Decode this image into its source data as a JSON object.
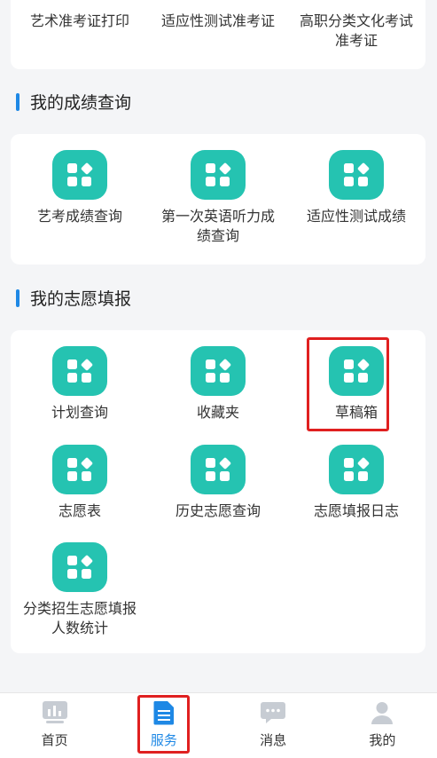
{
  "exam_cards": [
    {
      "label": "艺术准考证打印"
    },
    {
      "label": "适应性测试准考证"
    },
    {
      "label": "高职分类文化考试准考证"
    }
  ],
  "scores_section": {
    "title": "我的成绩查询",
    "items": [
      {
        "label": "艺考成绩查询"
      },
      {
        "label": "第一次英语听力成绩查询"
      },
      {
        "label": "适应性测试成绩"
      }
    ]
  },
  "volunteer_section": {
    "title": "我的志愿填报",
    "items": [
      {
        "label": "计划查询"
      },
      {
        "label": "收藏夹"
      },
      {
        "label": "草稿箱"
      },
      {
        "label": "志愿表"
      },
      {
        "label": "历史志愿查询"
      },
      {
        "label": "志愿填报日志"
      },
      {
        "label": "分类招生志愿填报人数统计"
      }
    ]
  },
  "tabbar": {
    "active": "服务",
    "tabs": [
      {
        "label": "首页",
        "icon": "chart-icon"
      },
      {
        "label": "服务",
        "icon": "document-icon"
      },
      {
        "label": "消息",
        "icon": "chat-icon"
      },
      {
        "label": "我的",
        "icon": "user-icon"
      }
    ]
  },
  "colors": {
    "accent": "#25c3b1",
    "primary": "#1e88e5",
    "highlight": "#e02020"
  }
}
